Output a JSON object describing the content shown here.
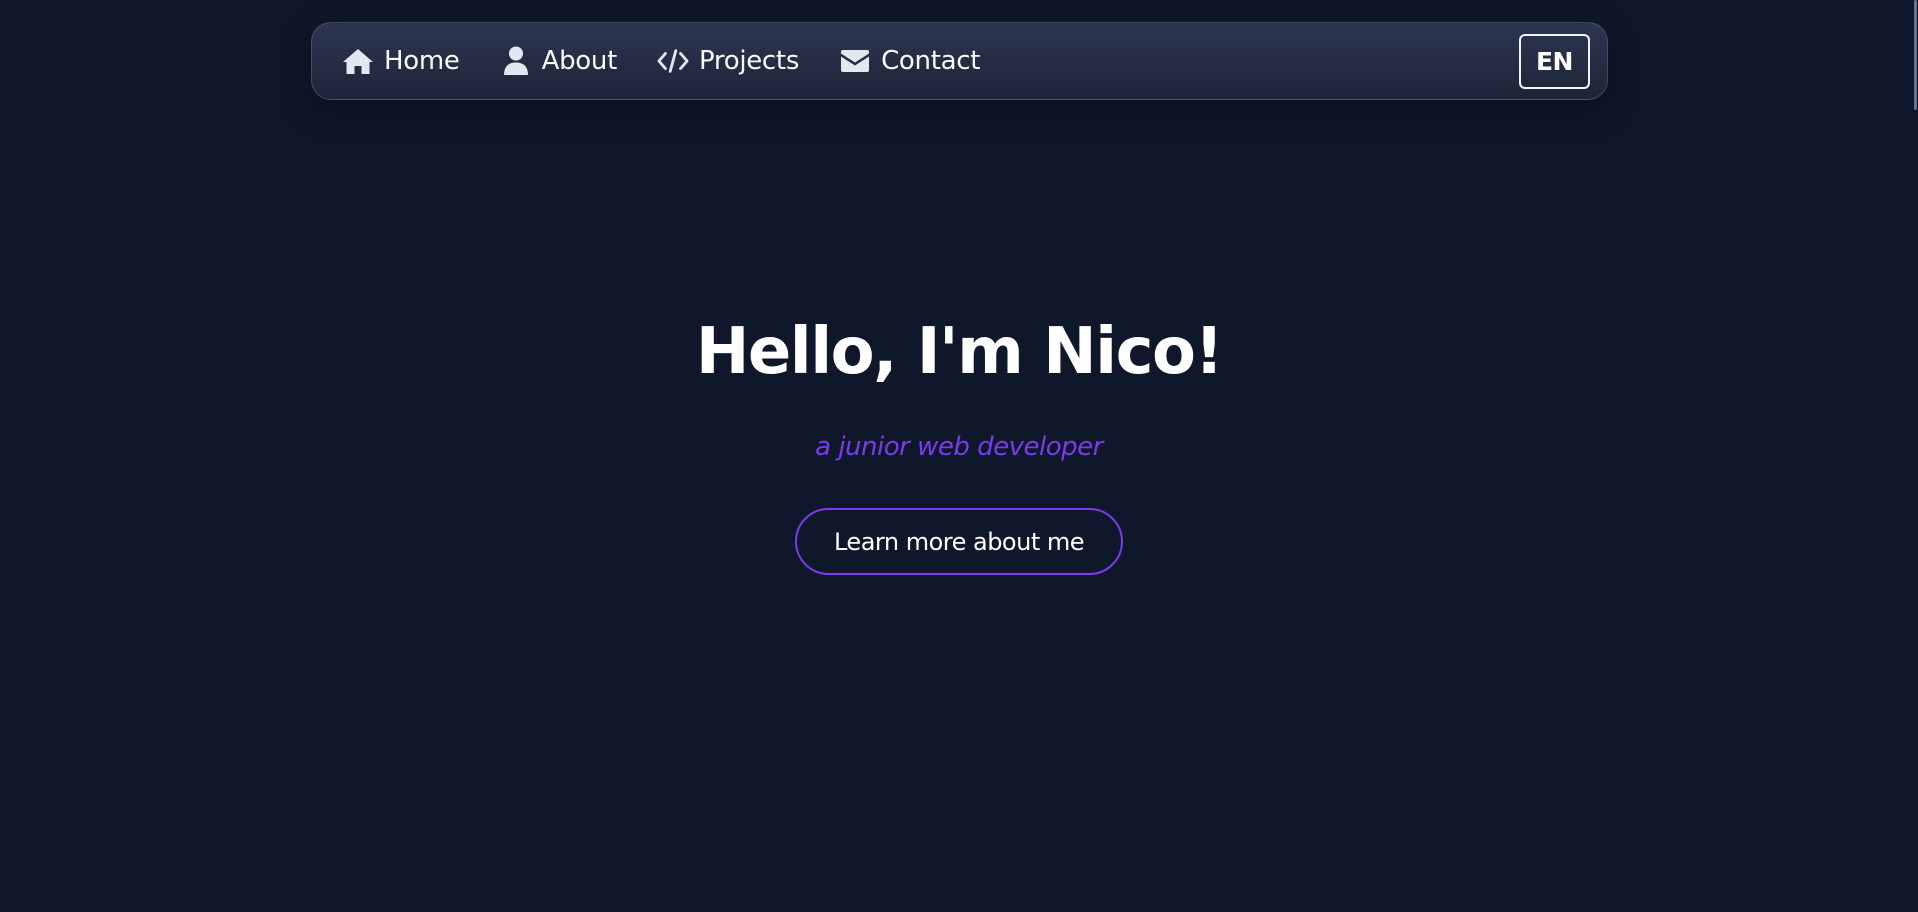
{
  "nav": {
    "items": [
      {
        "label": "Home",
        "icon": "home-icon"
      },
      {
        "label": "About",
        "icon": "user-icon"
      },
      {
        "label": "Projects",
        "icon": "code-icon"
      },
      {
        "label": "Contact",
        "icon": "envelope-icon"
      }
    ],
    "language": "EN"
  },
  "hero": {
    "title": "Hello, I'm Nico!",
    "subtitle": "a junior web developer",
    "cta_label": "Learn more about me"
  },
  "colors": {
    "background": "#0f172a",
    "accent": "#7c3aed",
    "navbar": "#232c42",
    "text": "#ffffff"
  }
}
